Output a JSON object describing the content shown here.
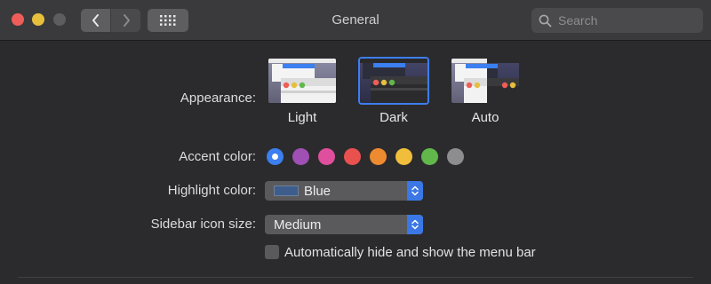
{
  "window": {
    "title": "General"
  },
  "search": {
    "placeholder": "Search"
  },
  "appearance": {
    "label": "Appearance:",
    "options": [
      {
        "name": "Light",
        "selected": false
      },
      {
        "name": "Dark",
        "selected": true
      },
      {
        "name": "Auto",
        "selected": false
      }
    ]
  },
  "accent": {
    "label": "Accent color:",
    "colors": [
      "#3b7ff0",
      "#a04fb4",
      "#e04f9e",
      "#e9514f",
      "#ee8a30",
      "#f1be3c",
      "#62b74b",
      "#8d8d8f"
    ],
    "selected_index": 0
  },
  "highlight": {
    "label": "Highlight color:",
    "value": "Blue",
    "swatch_color": "#3e5d8c"
  },
  "sidebar": {
    "label": "Sidebar icon size:",
    "value": "Medium"
  },
  "menubar": {
    "label": "Automatically hide and show the menu bar",
    "checked": false
  }
}
